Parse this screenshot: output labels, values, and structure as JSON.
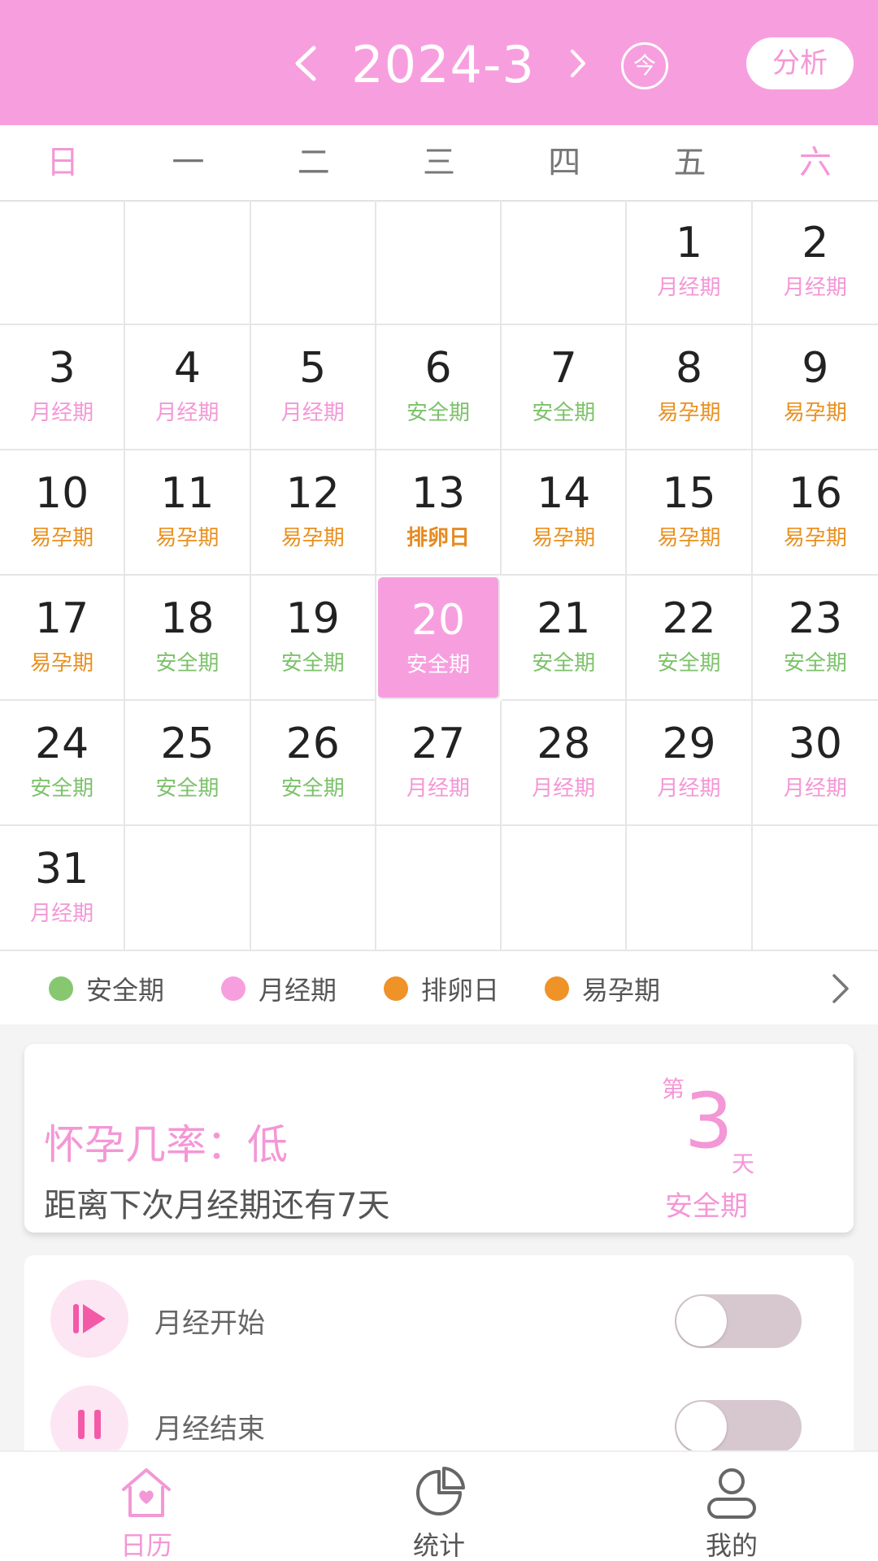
{
  "header": {
    "month_title": "2024-3",
    "today_label": "今",
    "analyze_label": "分析",
    "colors": {
      "header_bg": "#f79fde",
      "accent": "#f497d6"
    }
  },
  "weekdays": [
    "日",
    "一",
    "二",
    "三",
    "四",
    "五",
    "六"
  ],
  "calendar": {
    "selected_day": "20",
    "cells": [
      {
        "day": "",
        "tag": "",
        "type": ""
      },
      {
        "day": "",
        "tag": "",
        "type": ""
      },
      {
        "day": "",
        "tag": "",
        "type": ""
      },
      {
        "day": "",
        "tag": "",
        "type": ""
      },
      {
        "day": "",
        "tag": "",
        "type": ""
      },
      {
        "day": "1",
        "tag": "月经期",
        "type": "period"
      },
      {
        "day": "2",
        "tag": "月经期",
        "type": "period"
      },
      {
        "day": "3",
        "tag": "月经期",
        "type": "period"
      },
      {
        "day": "4",
        "tag": "月经期",
        "type": "period"
      },
      {
        "day": "5",
        "tag": "月经期",
        "type": "period"
      },
      {
        "day": "6",
        "tag": "安全期",
        "type": "safe"
      },
      {
        "day": "7",
        "tag": "安全期",
        "type": "safe"
      },
      {
        "day": "8",
        "tag": "易孕期",
        "type": "fertile"
      },
      {
        "day": "9",
        "tag": "易孕期",
        "type": "fertile"
      },
      {
        "day": "10",
        "tag": "易孕期",
        "type": "fertile"
      },
      {
        "day": "11",
        "tag": "易孕期",
        "type": "fertile"
      },
      {
        "day": "12",
        "tag": "易孕期",
        "type": "fertile"
      },
      {
        "day": "13",
        "tag": "排卵日",
        "type": "ovulation"
      },
      {
        "day": "14",
        "tag": "易孕期",
        "type": "fertile"
      },
      {
        "day": "15",
        "tag": "易孕期",
        "type": "fertile"
      },
      {
        "day": "16",
        "tag": "易孕期",
        "type": "fertile"
      },
      {
        "day": "17",
        "tag": "易孕期",
        "type": "fertile"
      },
      {
        "day": "18",
        "tag": "安全期",
        "type": "safe"
      },
      {
        "day": "19",
        "tag": "安全期",
        "type": "safe"
      },
      {
        "day": "20",
        "tag": "安全期",
        "type": "safe"
      },
      {
        "day": "21",
        "tag": "安全期",
        "type": "safe"
      },
      {
        "day": "22",
        "tag": "安全期",
        "type": "safe"
      },
      {
        "day": "23",
        "tag": "安全期",
        "type": "safe"
      },
      {
        "day": "24",
        "tag": "安全期",
        "type": "safe"
      },
      {
        "day": "25",
        "tag": "安全期",
        "type": "safe"
      },
      {
        "day": "26",
        "tag": "安全期",
        "type": "safe"
      },
      {
        "day": "27",
        "tag": "月经期",
        "type": "period"
      },
      {
        "day": "28",
        "tag": "月经期",
        "type": "period"
      },
      {
        "day": "29",
        "tag": "月经期",
        "type": "period"
      },
      {
        "day": "30",
        "tag": "月经期",
        "type": "period"
      },
      {
        "day": "31",
        "tag": "月经期",
        "type": "period"
      },
      {
        "day": "",
        "tag": "",
        "type": ""
      },
      {
        "day": "",
        "tag": "",
        "type": ""
      },
      {
        "day": "",
        "tag": "",
        "type": ""
      },
      {
        "day": "",
        "tag": "",
        "type": ""
      },
      {
        "day": "",
        "tag": "",
        "type": ""
      },
      {
        "day": "",
        "tag": "",
        "type": ""
      }
    ]
  },
  "legend": {
    "items": [
      {
        "label": "安全期",
        "color": "#86c76f"
      },
      {
        "label": "月经期",
        "color": "#f79fde"
      },
      {
        "label": "排卵日",
        "color": "#ef9227"
      },
      {
        "label": "易孕期",
        "color": "#ef9227"
      }
    ]
  },
  "status_card": {
    "probability": "怀孕几率：低",
    "distance": "距离下次月经期还有7天",
    "day_prefix": "第",
    "day_number": "3",
    "day_suffix": "天",
    "phase": "安全期"
  },
  "toggles": [
    {
      "label": "月经开始",
      "on": false,
      "icon": "play-icon"
    },
    {
      "label": "月经结束",
      "on": false,
      "icon": "pause-icon"
    }
  ],
  "bottom_nav": [
    {
      "label": "日历",
      "icon": "house-heart-icon",
      "active": true
    },
    {
      "label": "统计",
      "icon": "pie-chart-icon",
      "active": false
    },
    {
      "label": "我的",
      "icon": "user-icon",
      "active": false
    }
  ]
}
